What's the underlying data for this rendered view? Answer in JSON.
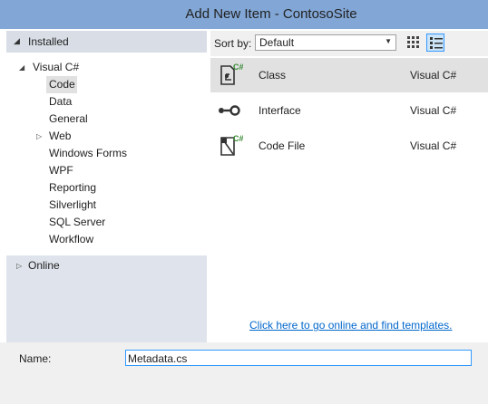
{
  "window": {
    "title": "Add New Item - ContosoSite"
  },
  "left_pane": {
    "installed_label": "Installed",
    "tree": {
      "root_label": "Visual C#",
      "children": [
        {
          "label": "Code",
          "selected": true
        },
        {
          "label": "Data"
        },
        {
          "label": "General"
        },
        {
          "label": "Web",
          "has_children": true
        },
        {
          "label": "Windows Forms"
        },
        {
          "label": "WPF"
        },
        {
          "label": "Reporting"
        },
        {
          "label": "Silverlight"
        },
        {
          "label": "SQL Server"
        },
        {
          "label": "Workflow"
        }
      ]
    },
    "online_label": "Online"
  },
  "sortbar": {
    "label": "Sort by:",
    "selected_value": "Default"
  },
  "templates": [
    {
      "name": "Class",
      "language": "Visual C#",
      "icon": "class-icon",
      "selected": true
    },
    {
      "name": "Interface",
      "language": "Visual C#",
      "icon": "interface-icon"
    },
    {
      "name": "Code File",
      "language": "Visual C#",
      "icon": "code-file-icon"
    }
  ],
  "online_link": "Click here to go online and find templates.",
  "name_field": {
    "label": "Name:",
    "value": "Metadata.cs"
  },
  "colors": {
    "titlebar": "#82a7d6",
    "accent": "#3399ff",
    "link": "#0066cc",
    "csharp_badge": "#388a34"
  }
}
